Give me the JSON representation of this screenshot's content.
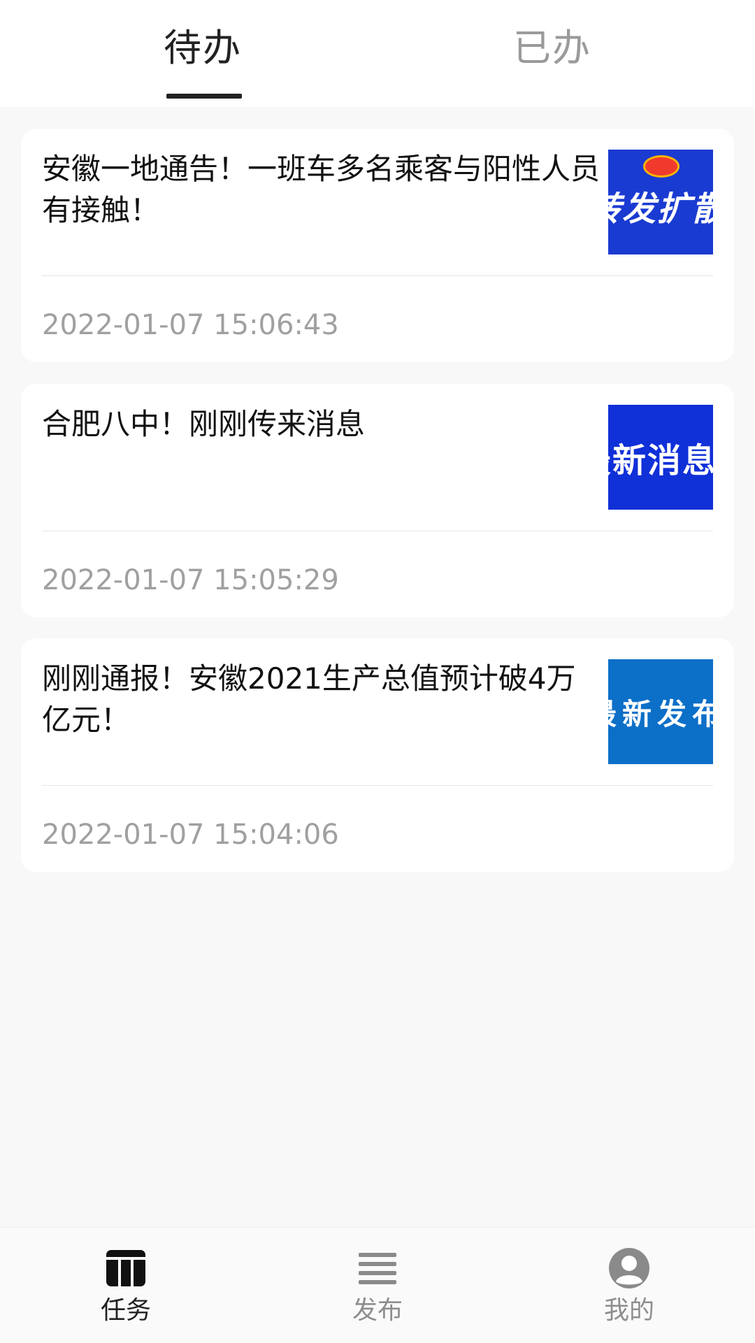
{
  "tabs": [
    {
      "label": "待办",
      "active": true
    },
    {
      "label": "已办",
      "active": false
    }
  ],
  "tasks": [
    {
      "title": "安徽一地通告！一班车多名乘客与阳性人员有接触！",
      "time": "2022-01-07 15:06:43",
      "thumb_text": "转发扩散",
      "thumb_color": "#1a3bd1"
    },
    {
      "title": "合肥八中！刚刚传来消息",
      "time": "2022-01-07 15:05:29",
      "thumb_text": "最新消息",
      "thumb_color": "#1030d8"
    },
    {
      "title": "刚刚通报！安徽2021生产总值预计破4万亿元！",
      "time": "2022-01-07 15:04:06",
      "thumb_text": "最新发布",
      "thumb_color": "#0c6fc8"
    }
  ],
  "bottom_nav": [
    {
      "label": "任务",
      "icon": "task-table-icon",
      "active": true
    },
    {
      "label": "发布",
      "icon": "list-lines-icon",
      "active": false
    },
    {
      "label": "我的",
      "icon": "user-avatar-icon",
      "active": false
    }
  ],
  "colors": {
    "active": "#222222",
    "inactive": "#9a9a9a",
    "background": "#f8f8f8"
  }
}
